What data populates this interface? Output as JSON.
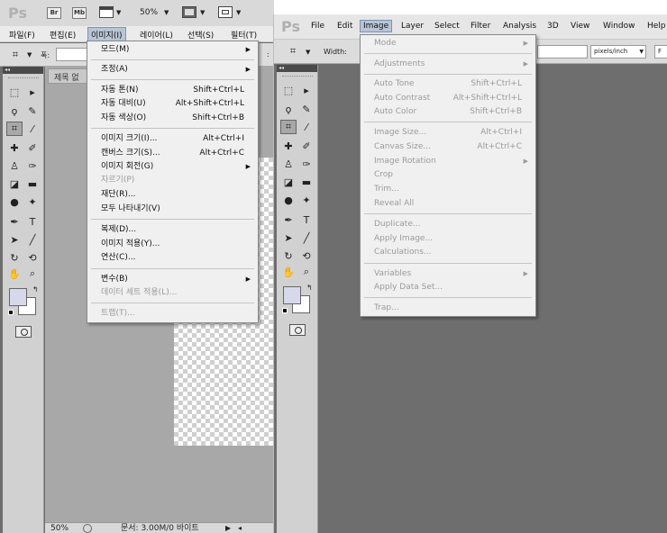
{
  "colors": {
    "menu_bg": "#f0f0f0",
    "workspace_gray": "#6e6e6e",
    "highlight": "#b8c5d6",
    "foreground_swatch": "#d8d8ec"
  },
  "ko": {
    "app_logo": "Ps",
    "topbar": {
      "br": "Br",
      "mb": "Mb",
      "zoom": "50%"
    },
    "menubar": [
      "파일(F)",
      "편집(E)",
      "이미지(I)",
      "레이어(L)",
      "선택(S)",
      "필터(T)"
    ],
    "options": {
      "width_label": "폭:",
      "colon": ":"
    },
    "doc_tab": "제목 없",
    "status": {
      "zoom": "50%",
      "doc": "문서: 3.00M/0 바이트"
    },
    "image_menu": {
      "mode": "모드(M)",
      "adjustments": "조정(A)",
      "auto_tone": "자동 톤(N)",
      "auto_tone_sc": "Shift+Ctrl+L",
      "auto_contrast": "자동 대비(U)",
      "auto_contrast_sc": "Alt+Shift+Ctrl+L",
      "auto_color": "자동 색상(O)",
      "auto_color_sc": "Shift+Ctrl+B",
      "image_size": "이미지 크기(I)...",
      "image_size_sc": "Alt+Ctrl+I",
      "canvas_size": "캔버스 크기(S)...",
      "canvas_size_sc": "Alt+Ctrl+C",
      "image_rotation": "이미지 회전(G)",
      "crop": "자르기(P)",
      "trim": "재단(R)...",
      "reveal_all": "모두 나타내기(V)",
      "duplicate": "복제(D)...",
      "apply_image": "이미지 적용(Y)...",
      "calculations": "연산(C)...",
      "variables": "변수(B)",
      "apply_data_set": "데이터 세트 적용(L)...",
      "trap": "트랩(T)..."
    }
  },
  "en": {
    "app_logo": "Ps",
    "menubar": [
      "File",
      "Edit",
      "Image",
      "Layer",
      "Select",
      "Filter",
      "Analysis",
      "3D",
      "View",
      "Window",
      "Help"
    ],
    "options": {
      "width_label": "Width:",
      "units": "pixels/inch",
      "right_btn": "F"
    },
    "image_menu": {
      "mode": "Mode",
      "adjustments": "Adjustments",
      "auto_tone": "Auto Tone",
      "auto_tone_sc": "Shift+Ctrl+L",
      "auto_contrast": "Auto Contrast",
      "auto_contrast_sc": "Alt+Shift+Ctrl+L",
      "auto_color": "Auto Color",
      "auto_color_sc": "Shift+Ctrl+B",
      "image_size": "Image Size...",
      "image_size_sc": "Alt+Ctrl+I",
      "canvas_size": "Canvas Size...",
      "canvas_size_sc": "Alt+Ctrl+C",
      "image_rotation": "Image Rotation",
      "crop": "Crop",
      "trim": "Trim...",
      "reveal_all": "Reveal All",
      "duplicate": "Duplicate...",
      "apply_image": "Apply Image...",
      "calculations": "Calculations...",
      "variables": "Variables",
      "apply_data_set": "Apply Data Set...",
      "trap": "Trap..."
    }
  }
}
